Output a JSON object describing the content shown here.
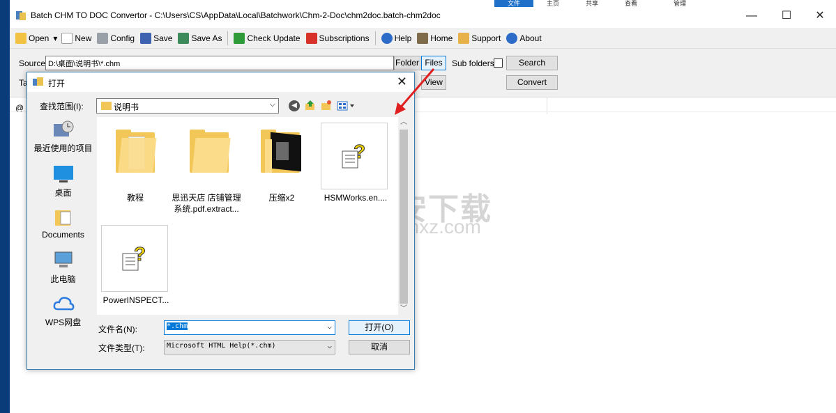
{
  "window": {
    "title": "Batch CHM TO DOC Convertor - C:\\Users\\CS\\AppData\\Local\\Batchwork\\Chm-2-Doc\\chm2doc.batch-chm2doc",
    "ribbon_tabs": [
      "文件",
      "主页",
      "共享",
      "查看",
      "管理"
    ],
    "controls": {
      "minimize": "—",
      "maximize": "☐",
      "close": "✕"
    }
  },
  "toolbar": {
    "open": "Open",
    "new": "New",
    "config": "Config",
    "save": "Save",
    "save_as": "Save As",
    "check_update": "Check Update",
    "subscriptions": "Subscriptions",
    "help": "Help",
    "home": "Home",
    "support": "Support",
    "about": "About"
  },
  "form": {
    "source_label": "Source",
    "source_value": "D:\\桌面\\说明书\\*.chm",
    "folder_btn": "Folder",
    "files_btn": "Files",
    "subfolders_label": "Sub folders",
    "search_btn": "Search",
    "target_label_partial": "Ta",
    "view_btn": "View",
    "convert_btn": "Convert",
    "at_symbol": "@"
  },
  "watermark": {
    "text": "安下载",
    "sub": "anxz.com"
  },
  "dialog": {
    "title": "打开",
    "lookin_label": "查找范围(I):",
    "lookin_value": "说明书",
    "places": [
      {
        "label": "最近使用的项目",
        "icon": "recent-icon"
      },
      {
        "label": "桌面",
        "icon": "desktop-icon"
      },
      {
        "label": "Documents",
        "icon": "documents-icon"
      },
      {
        "label": "此电脑",
        "icon": "computer-icon"
      },
      {
        "label": "WPS网盘",
        "icon": "cloud-icon"
      }
    ],
    "files": [
      {
        "name": "教程",
        "type": "folder"
      },
      {
        "name": "思迅天店 店铺管理系统.pdf.extract...",
        "line1": "思迅天店 店铺管理",
        "line2": "系统.pdf.extract...",
        "type": "folder"
      },
      {
        "name": "压缩x2",
        "type": "folder"
      },
      {
        "name": "HSMWorks.en....",
        "type": "chm"
      },
      {
        "name": "PowerINSPECT...",
        "type": "chm"
      }
    ],
    "filename_label": "文件名(N):",
    "filename_value": "*.chm",
    "filetype_label": "文件类型(T):",
    "filetype_value": "Microsoft HTML Help(*.chm)",
    "open_btn": "打开(O)",
    "cancel_btn": "取消"
  }
}
